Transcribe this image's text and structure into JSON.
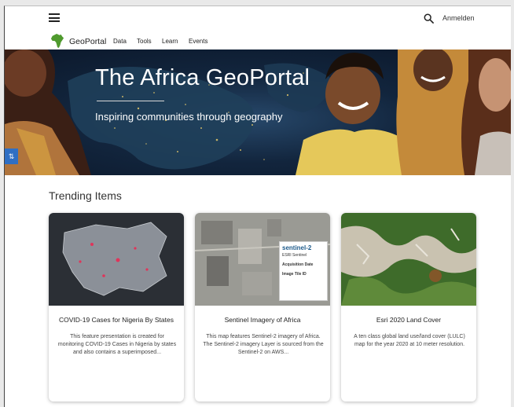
{
  "topbar": {
    "signin_label": "Anmelden"
  },
  "nav": {
    "brand": "GeoPortal",
    "items": [
      "Data",
      "Tools",
      "Learn",
      "Events"
    ]
  },
  "hero": {
    "title": "The Africa GeoPortal",
    "subtitle": "Inspiring communities through geography"
  },
  "trending": {
    "title": "Trending Items",
    "cards": [
      {
        "title": "COVID-19 Cases for Nigeria By States",
        "description": "This feature presentation is created for monitoring COVID-19 Cases in Nigeria by states and also contains a superimposed..."
      },
      {
        "title": "Sentinel Imagery of Africa",
        "description": "This map features Sentinel-2 imagery of Africa. The Sentinel-2 imagery Layer is sourced from the Sentinel-2 on AWS...",
        "thumb_popup": {
          "heading": "sentinel-2",
          "sub": "ESRI Sentinel",
          "rows": [
            "Acquisition Date",
            "Image Tile ID"
          ]
        }
      },
      {
        "title": "Esri 2020 Land Cover",
        "description": "A ten class global land use/land cover (LULC) map for the year 2020 at 10 meter resolution."
      }
    ]
  },
  "colors": {
    "accent_blue": "#2f6fc4",
    "logo_green": "#4f9a2e",
    "hero_night": "#12253d"
  }
}
